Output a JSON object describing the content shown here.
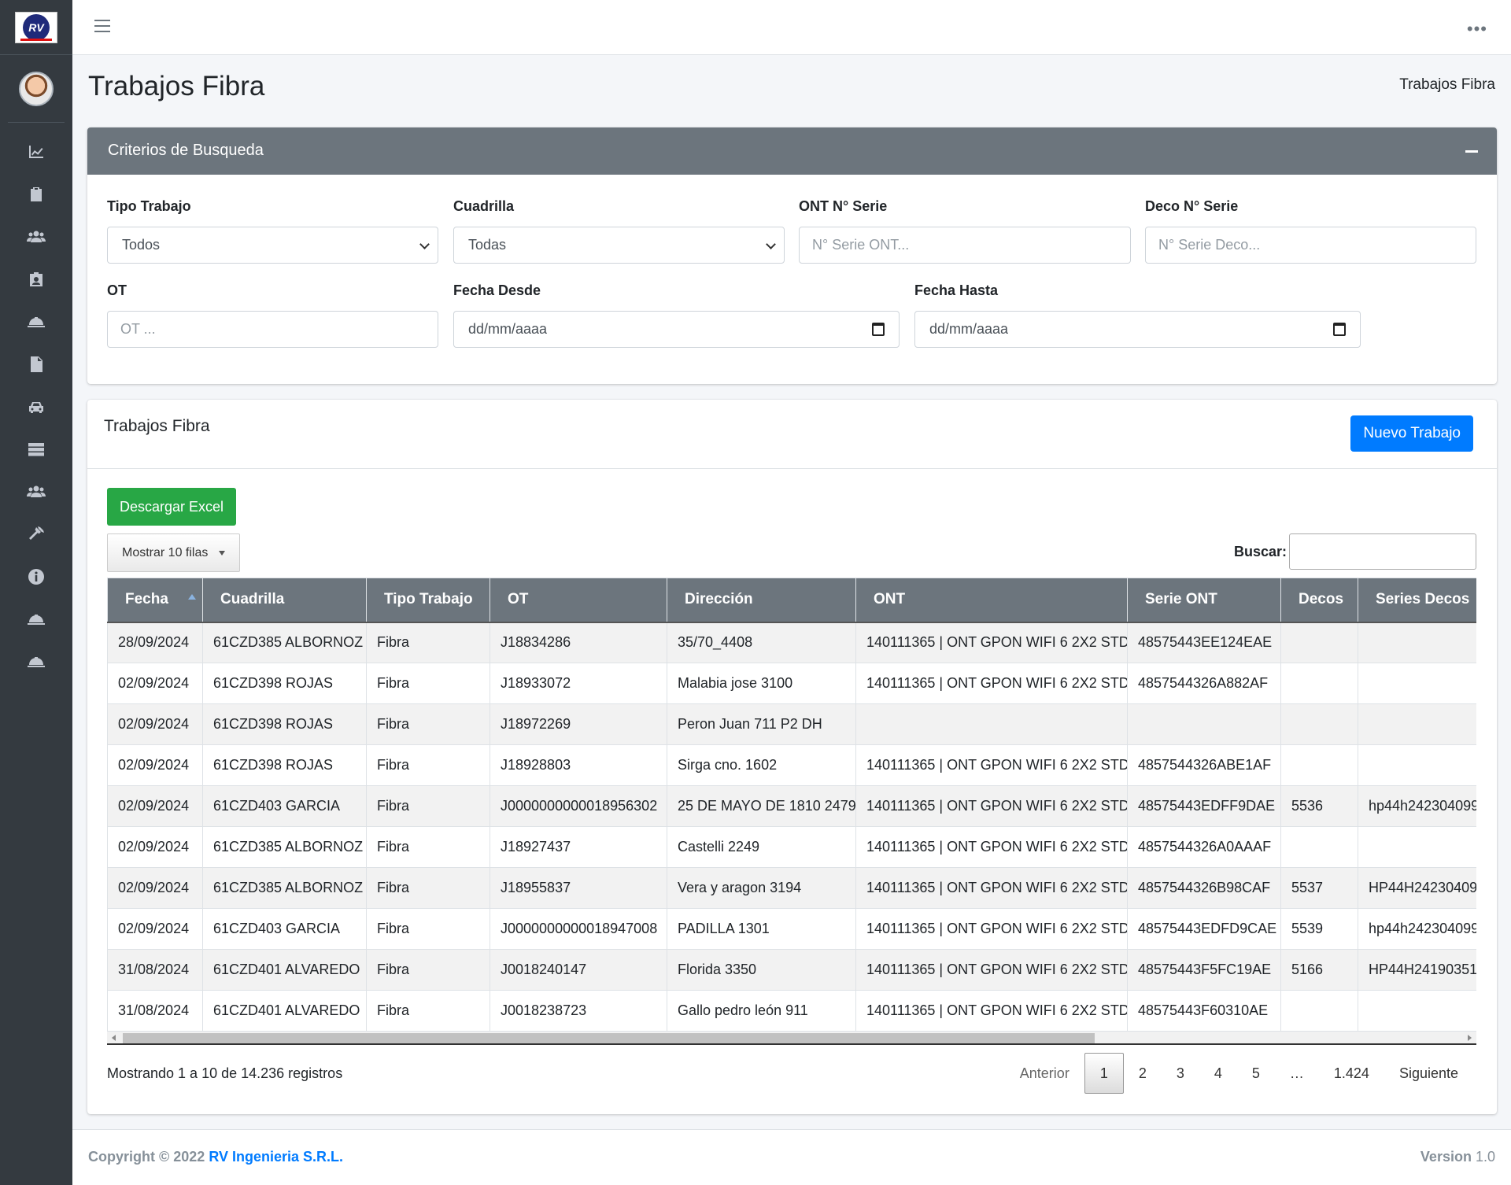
{
  "logo_text": "RV",
  "page": {
    "title": "Trabajos Fibra",
    "breadcrumb": "Trabajos Fibra"
  },
  "search": {
    "header": "Criterios de Busqueda",
    "tipo_trabajo": {
      "label": "Tipo Trabajo",
      "value": "Todos"
    },
    "cuadrilla": {
      "label": "Cuadrilla",
      "value": "Todas"
    },
    "ont_serie": {
      "label": "ONT N° Serie",
      "placeholder": "N° Serie ONT..."
    },
    "deco_serie": {
      "label": "Deco N° Serie",
      "placeholder": "N° Serie Deco..."
    },
    "ot": {
      "label": "OT",
      "placeholder": "OT ..."
    },
    "fecha_desde": {
      "label": "Fecha Desde",
      "value": "dd/mm/aaaa"
    },
    "fecha_hasta": {
      "label": "Fecha Hasta",
      "value": "dd/mm/aaaa"
    }
  },
  "jobs": {
    "title": "Trabajos Fibra",
    "new_button": "Nuevo Trabajo",
    "excel_button": "Descargar Excel",
    "show_rows": "Mostrar 10 filas",
    "search_label": "Buscar:",
    "columns": [
      "Fecha",
      "Cuadrilla",
      "Tipo Trabajo",
      "OT",
      "Dirección",
      "ONT",
      "Serie ONT",
      "Decos",
      "Series Decos"
    ],
    "rows": [
      [
        "28/09/2024",
        "61CZD385 ALBORNOZ",
        "Fibra",
        "J18834286",
        "35/70_4408",
        "140111365 | ONT GPON WIFI 6 2X2 STD",
        "48575443EE124EAE",
        "",
        ""
      ],
      [
        "02/09/2024",
        "61CZD398 ROJAS",
        "Fibra",
        "J18933072",
        "Malabia jose 3100",
        "140111365 | ONT GPON WIFI 6 2X2 STD",
        "4857544326A882AF",
        "",
        ""
      ],
      [
        "02/09/2024",
        "61CZD398 ROJAS",
        "Fibra",
        "J18972269",
        "Peron Juan 711 P2 DH",
        "",
        "",
        "",
        ""
      ],
      [
        "02/09/2024",
        "61CZD398 ROJAS",
        "Fibra",
        "J18928803",
        "Sirga cno. 1602",
        "140111365 | ONT GPON WIFI 6 2X2 STD",
        "4857544326ABE1AF",
        "",
        ""
      ],
      [
        "02/09/2024",
        "61CZD403 GARCIA",
        "Fibra",
        "J0000000000018956302",
        "25 DE MAYO DE 1810 2479",
        "140111365 | ONT GPON WIFI 6 2X2 STD",
        "48575443EDFF9DAE",
        "5536",
        "hp44h242304099"
      ],
      [
        "02/09/2024",
        "61CZD385 ALBORNOZ",
        "Fibra",
        "J18927437",
        "Castelli 2249",
        "140111365 | ONT GPON WIFI 6 2X2 STD",
        "4857544326A0AAAF",
        "",
        ""
      ],
      [
        "02/09/2024",
        "61CZD385 ALBORNOZ",
        "Fibra",
        "J18955837",
        "Vera y aragon 3194",
        "140111365 | ONT GPON WIFI 6 2X2 STD",
        "4857544326B98CAF",
        "5537",
        "HP44H24230409"
      ],
      [
        "02/09/2024",
        "61CZD403 GARCIA",
        "Fibra",
        "J0000000000018947008",
        "PADILLA 1301",
        "140111365 | ONT GPON WIFI 6 2X2 STD",
        "48575443EDFD9CAE",
        "5539",
        "hp44h242304099"
      ],
      [
        "31/08/2024",
        "61CZD401 ALVAREDO",
        "Fibra",
        "J0018240147",
        "Florida 3350",
        "140111365 | ONT GPON WIFI 6 2X2 STD",
        "48575443F5FC19AE",
        "5166",
        "HP44H24190351"
      ],
      [
        "31/08/2024",
        "61CZD401 ALVAREDO",
        "Fibra",
        "J0018238723",
        "Gallo pedro león 911",
        "140111365 | ONT GPON WIFI 6 2X2 STD",
        "48575443F60310AE",
        "",
        ""
      ]
    ],
    "info": "Mostrando 1 a 10 de 14.236 registros",
    "pagination": {
      "prev": "Anterior",
      "pages": [
        "1",
        "2",
        "3",
        "4",
        "5",
        "…",
        "1.424"
      ],
      "next": "Siguiente",
      "current": "1"
    }
  },
  "footer": {
    "copyright": "Copyright © 2022",
    "company": "RV Ingenieria S.R.L.",
    "version_label": "Version",
    "version": "1.0"
  },
  "sidebar_icons": [
    "chart-line-icon",
    "clipboard-icon",
    "users-icon",
    "id-card-icon",
    "hard-hat-icon",
    "file-icon",
    "car-icon",
    "server-icon",
    "users-icon",
    "hammer-icon",
    "info-circle-icon",
    "hard-hat-icon",
    "hard-hat-icon"
  ]
}
